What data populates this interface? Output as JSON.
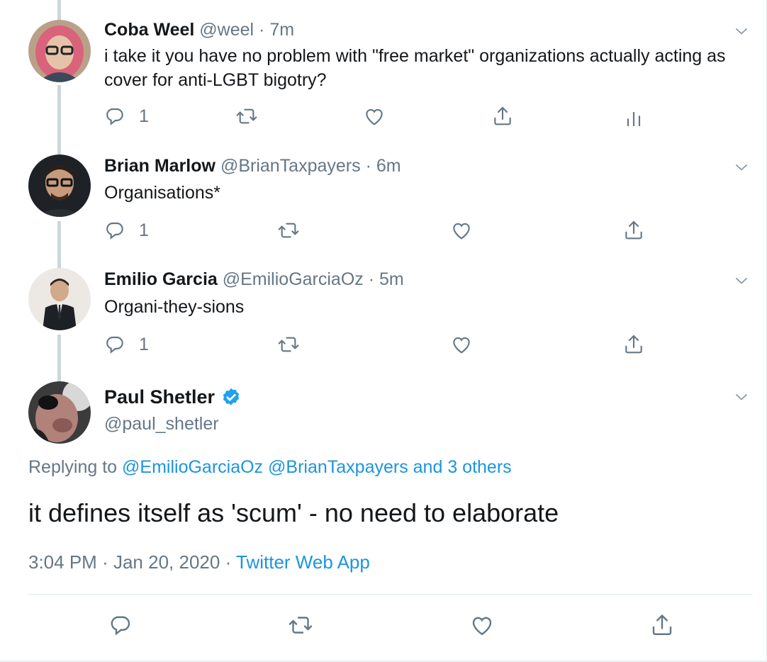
{
  "tweets": [
    {
      "name": "Coba Weel",
      "handle": "@weel",
      "sep": "·",
      "time": "7m",
      "text": "i take it you have no problem with \"free market\" organizations actually acting as cover for anti-LGBT bigotry?",
      "reply_count": "1"
    },
    {
      "name": "Brian Marlow",
      "handle": "@BrianTaxpayers",
      "sep": "·",
      "time": "6m",
      "text": "Organisations*",
      "reply_count": "1"
    },
    {
      "name": "Emilio Garcia",
      "handle": "@EmilioGarciaOz",
      "sep": "·",
      "time": "5m",
      "text": "Organi-they-sions",
      "reply_count": "1"
    }
  ],
  "main_tweet": {
    "name": "Paul Shetler",
    "handle": "@paul_shetler",
    "replying_prefix": "Replying to",
    "replying_user1": "@EmilioGarciaOz",
    "replying_user2": "@BrianTaxpayers",
    "replying_others": "and 3 others",
    "text": "it defines itself as 'scum' - no need to elaborate",
    "time": "3:04 PM",
    "sep1": "·",
    "date": "Jan 20, 2020",
    "sep2": "·",
    "source": "Twitter Web App"
  },
  "colors": {
    "link": "#1b95e0",
    "secondary": "#657786",
    "thread": "#ccd6dd",
    "verified": "#1da1f2"
  },
  "icons": [
    "reply-icon",
    "retweet-icon",
    "like-icon",
    "share-icon",
    "analytics-icon",
    "chevron-down-icon",
    "verified-badge-icon"
  ]
}
